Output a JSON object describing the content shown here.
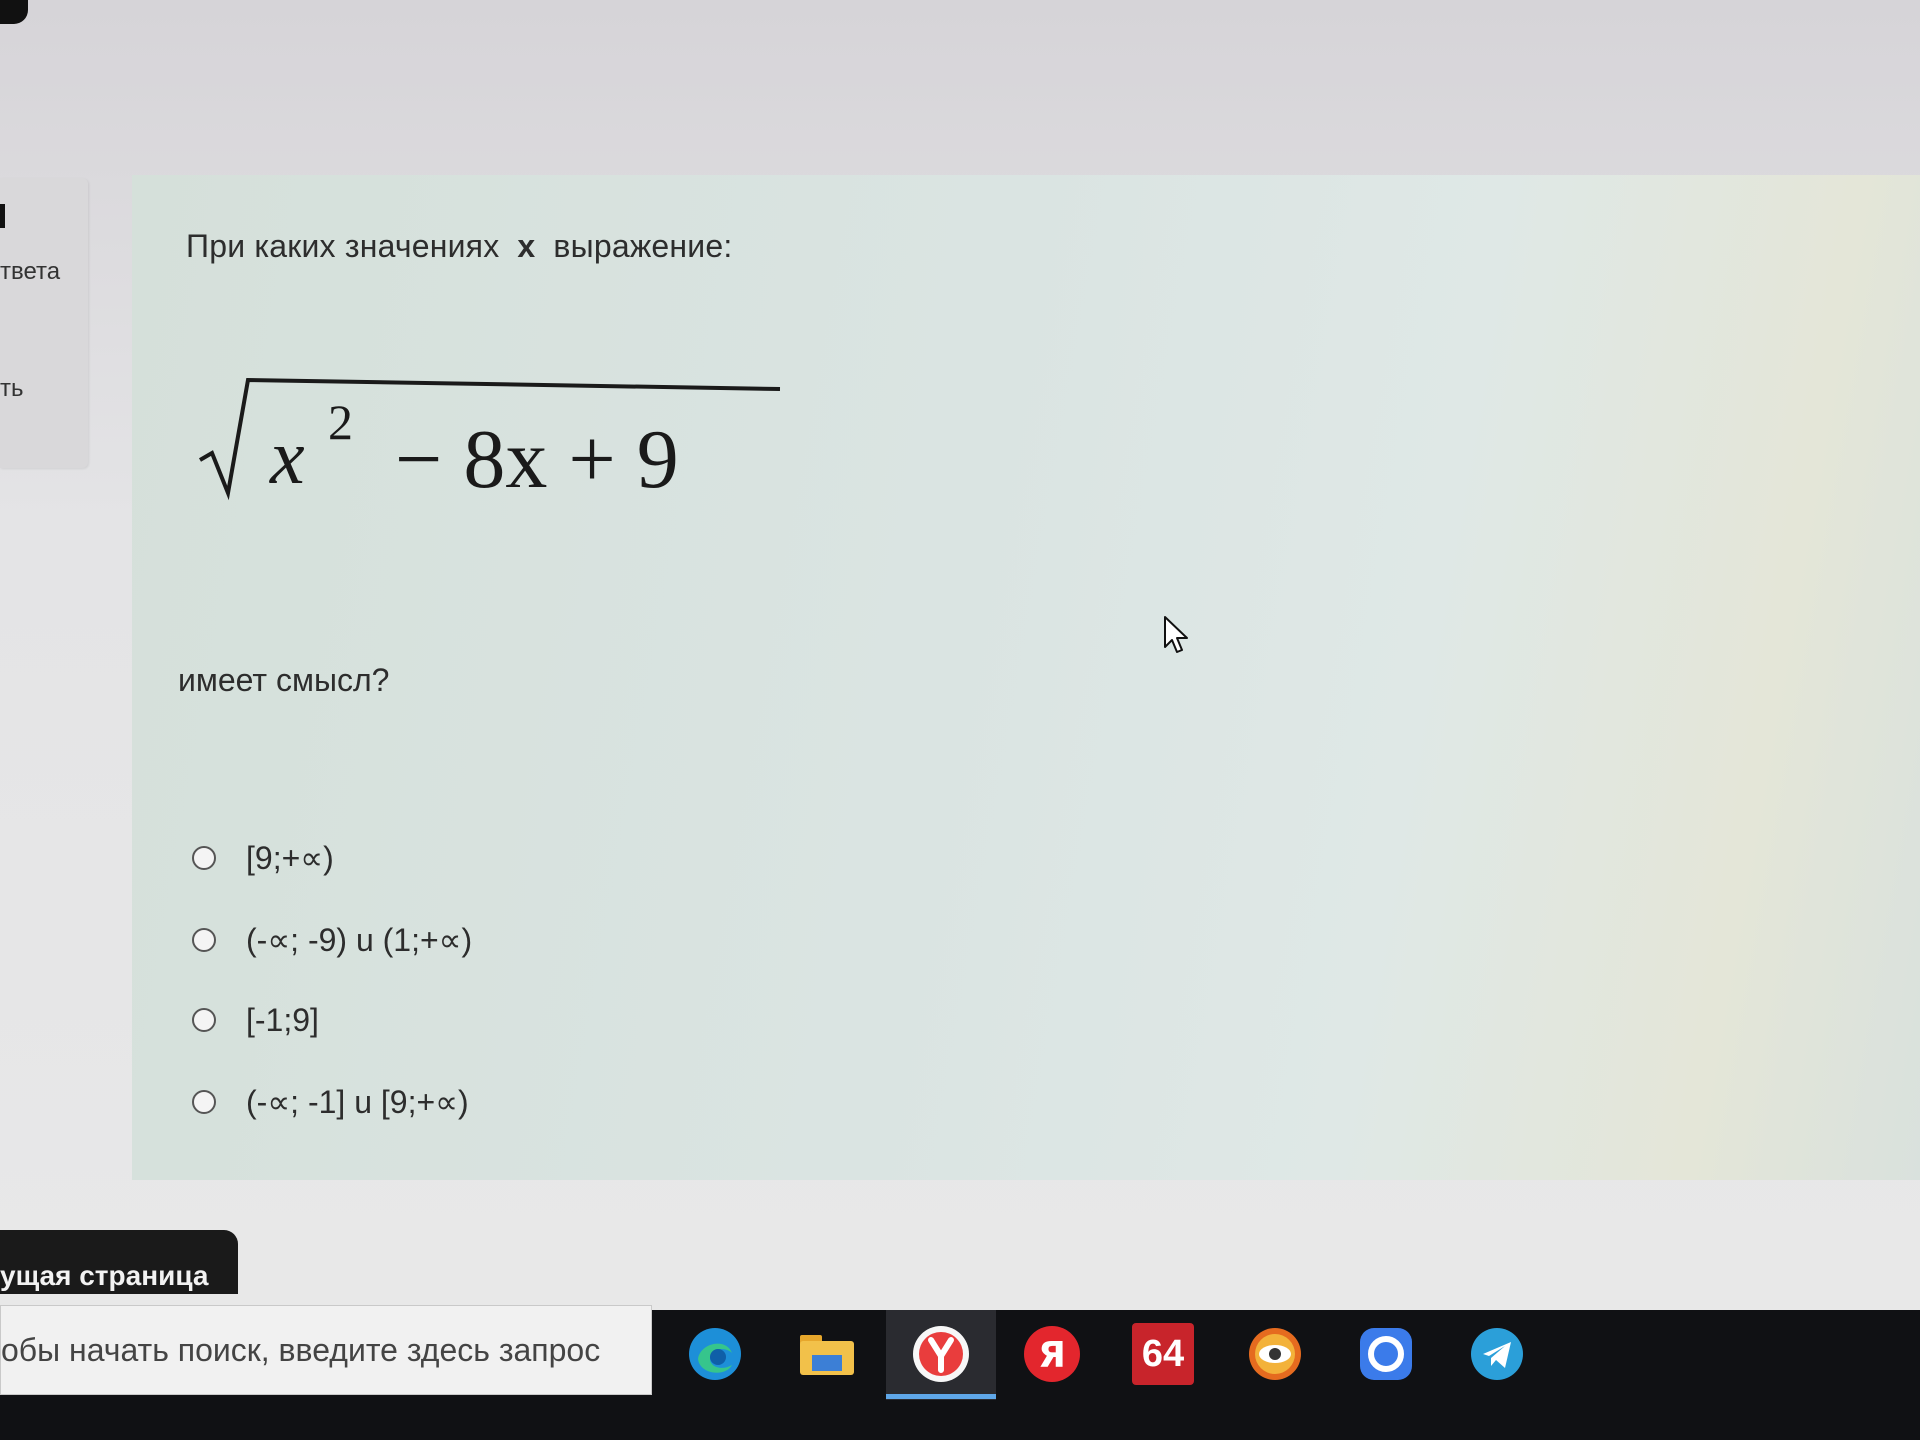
{
  "left_panel": {
    "text_1": "твета",
    "text_2": "ть"
  },
  "question": {
    "prefix": "При каких значениях",
    "variable": "x",
    "suffix": "выражение:",
    "tail": "имеет смысл?",
    "formula": {
      "radicand_base": "x",
      "exponent": "2",
      "rest": "− 8x + 9"
    }
  },
  "options": [
    {
      "label": "[9;+∝)"
    },
    {
      "label": "(-∝; -9) u (1;+∝)"
    },
    {
      "label": "[-1;9]"
    },
    {
      "label": "(-∝; -1] u [9;+∝)"
    }
  ],
  "navigation": {
    "next_page_label": "ущая страница"
  },
  "taskbar": {
    "search_placeholder": "обы начать поиск, введите здесь запрос",
    "badge_number": "64",
    "icons": [
      "edge-icon",
      "file-explorer-icon",
      "yandex-browser-icon",
      "yandex-icon",
      "aida64-icon",
      "eye-app-icon",
      "chat-icon",
      "telegram-icon"
    ]
  },
  "colors": {
    "taskbar": "#101114",
    "card": "#dae4e2",
    "active_indicator": "#5fa7e8"
  }
}
